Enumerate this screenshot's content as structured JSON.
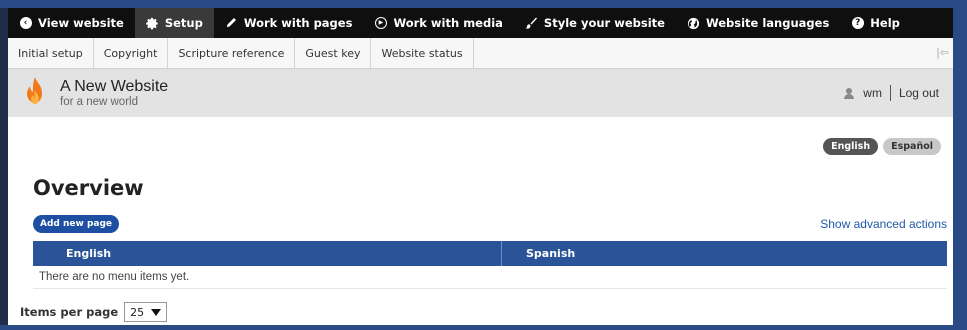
{
  "admin_bar": {
    "items": [
      {
        "label": "View website",
        "icon": "back-circle-icon",
        "active": false
      },
      {
        "label": "Setup",
        "icon": "gear-icon",
        "active": true
      },
      {
        "label": "Work with pages",
        "icon": "pencil-icon",
        "active": false
      },
      {
        "label": "Work with media",
        "icon": "play-circle-icon",
        "active": false
      },
      {
        "label": "Style your website",
        "icon": "brush-icon",
        "active": false
      },
      {
        "label": "Website languages",
        "icon": "globe-icon",
        "active": false
      },
      {
        "label": "Help",
        "icon": "help-circle-icon",
        "active": false
      }
    ]
  },
  "sub_tabs": {
    "items": [
      "Initial setup",
      "Copyright",
      "Scripture reference",
      "Guest key",
      "Website status"
    ],
    "toggle_icon": "sidebar-toggle-icon"
  },
  "site": {
    "name": "A New Website",
    "slogan": "for a new world",
    "logo_icon": "flame-logo-icon",
    "username": "wm",
    "logout": "Log out"
  },
  "languages": {
    "items": [
      {
        "label": "English",
        "active": true
      },
      {
        "label": "Español",
        "active": false
      }
    ]
  },
  "main": {
    "title": "Overview",
    "add_button": "Add new page",
    "advanced_link": "Show advanced actions",
    "table": {
      "columns": [
        "English",
        "Spanish"
      ],
      "empty_message": "There are no menu items yet."
    },
    "pager": {
      "label": "Items per page",
      "value": "25"
    }
  },
  "colors": {
    "admin_bar": "#0f0f0f",
    "primary": "#1f4fa3",
    "table_header": "#2b5397",
    "link": "#1f5aaa"
  }
}
